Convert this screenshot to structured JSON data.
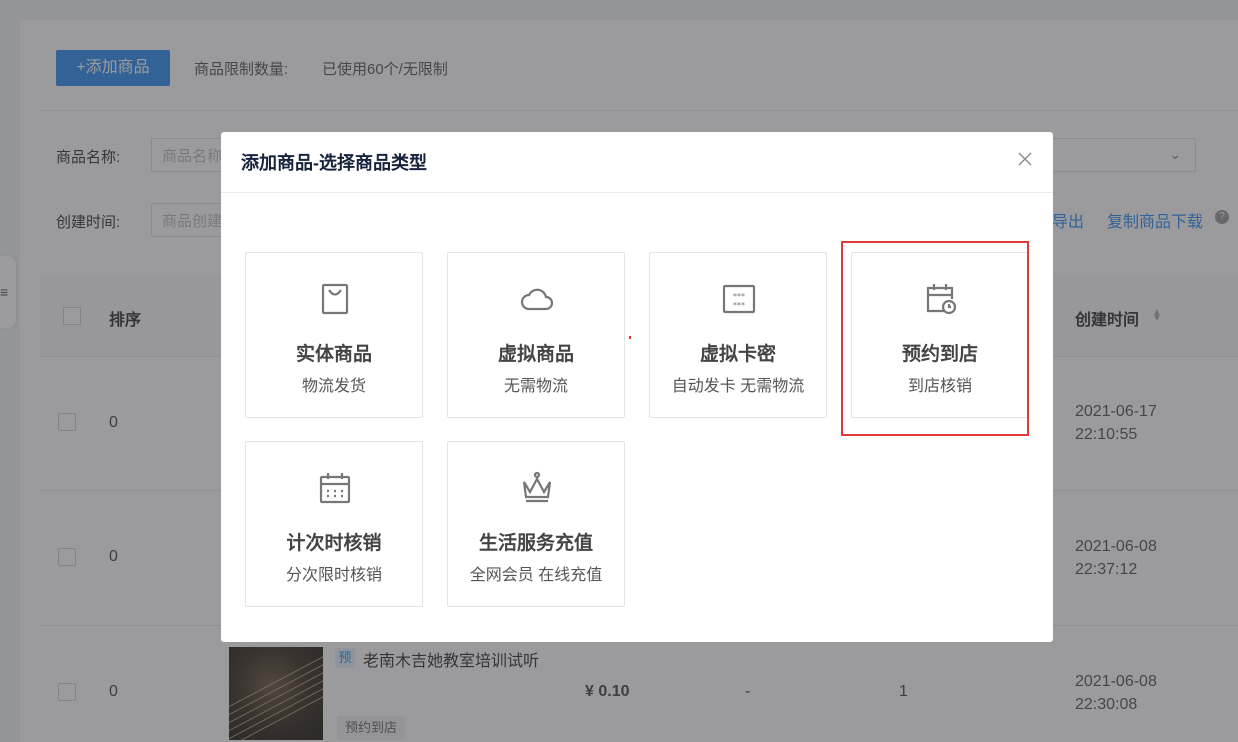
{
  "toolbar": {
    "add_button": "+添加商品",
    "limit_label": "商品限制数量:",
    "limit_value": "已使用60个/无限制"
  },
  "filters": {
    "name_label": "商品名称:",
    "name_placeholder": "商品名称",
    "time_label": "创建时间:",
    "time_placeholder": "商品创建",
    "export_link": "导出",
    "copy_download_link": "复制商品下载"
  },
  "table": {
    "headers": {
      "sort": "排序",
      "created": "创建时间"
    },
    "rows": [
      {
        "sort": "0",
        "date": "2021-06-17",
        "time": "22:10:55"
      },
      {
        "sort": "0",
        "date": "2021-06-08",
        "time": "22:37:12"
      },
      {
        "sort": "0",
        "date": "2021-06-08",
        "time": "22:30:08",
        "tag": "预",
        "title": "老南木吉她教室培训试听",
        "price": "¥ 0.10",
        "col_a": "-",
        "col_b": "1",
        "type_tag": "预约到店"
      }
    ]
  },
  "modal": {
    "title": "添加商品-选择商品类型",
    "types": [
      {
        "title": "实体商品",
        "subtitle": "物流发货",
        "icon": "shopping-bag-icon"
      },
      {
        "title": "虚拟商品",
        "subtitle": "无需物流",
        "icon": "cloud-icon"
      },
      {
        "title": "虚拟卡密",
        "subtitle": "自动发卡 无需物流",
        "icon": "card-code-icon"
      },
      {
        "title": "预约到店",
        "subtitle": "到店核销",
        "icon": "calendar-clock-icon"
      },
      {
        "title": "计次时核销",
        "subtitle": "分次限时核销",
        "icon": "calendar-icon"
      },
      {
        "title": "生活服务充值",
        "subtitle": "全网会员 在线充值",
        "icon": "crown-icon"
      }
    ]
  },
  "colors": {
    "primary": "#2d8cf0",
    "highlight": "#e53935"
  }
}
